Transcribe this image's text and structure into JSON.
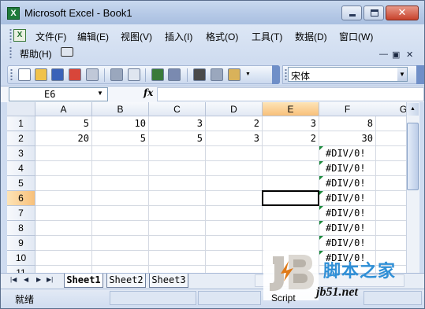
{
  "window": {
    "title": "Microsoft Excel - Book1"
  },
  "menu": {
    "items": [
      "文件(F)",
      "编辑(E)",
      "视图(V)",
      "插入(I)",
      "格式(O)",
      "工具(T)",
      "数据(D)",
      "窗口(W)"
    ],
    "help": "帮助(H)"
  },
  "icons": {
    "toolbar": [
      "new-icon",
      "open-icon",
      "save-icon",
      "permission-icon",
      "email-icon",
      "print-icon",
      "print-preview-icon",
      "spelling-icon",
      "research-icon",
      "cut-icon",
      "copy-icon",
      "paste-icon"
    ],
    "fx": "fx"
  },
  "font": {
    "name": "宋体"
  },
  "namebox": {
    "value": "E6"
  },
  "grid": {
    "columns": [
      "A",
      "B",
      "C",
      "D",
      "E",
      "F",
      "G"
    ],
    "active_column": "E",
    "rows": [
      "1",
      "2",
      "3",
      "4",
      "5",
      "6",
      "7",
      "8",
      "9",
      "10",
      "11"
    ],
    "active_row": "6",
    "cells": [
      [
        "5",
        "10",
        "3",
        "2",
        "3",
        "8"
      ],
      [
        "20",
        "5",
        "5",
        "3",
        "2",
        "30"
      ],
      [
        "",
        "",
        "",
        "",
        "",
        "#DIV/0!"
      ],
      [
        "",
        "",
        "",
        "",
        "",
        "#DIV/0!"
      ],
      [
        "",
        "",
        "",
        "",
        "",
        "#DIV/0!"
      ],
      [
        "",
        "",
        "",
        "",
        "",
        "#DIV/0!"
      ],
      [
        "",
        "",
        "",
        "",
        "",
        "#DIV/0!"
      ],
      [
        "",
        "",
        "",
        "",
        "",
        "#DIV/0!"
      ],
      [
        "",
        "",
        "",
        "",
        "",
        "#DIV/0!"
      ],
      [
        "",
        "",
        "",
        "",
        "",
        "#DIV/0!"
      ],
      [
        "",
        "",
        "",
        "",
        "",
        ""
      ]
    ]
  },
  "sheets": [
    "Sheet1",
    "Sheet2",
    "Sheet3"
  ],
  "active_sheet": "Sheet1",
  "status": {
    "text": "就绪"
  },
  "watermark": {
    "cn": "脚本之家",
    "url": "jb51.net",
    "script": "Script"
  },
  "colors": {
    "active_header": "#f8c07a",
    "error_marker": "#1c8a3c",
    "title_bar": "#b4c8e6"
  }
}
